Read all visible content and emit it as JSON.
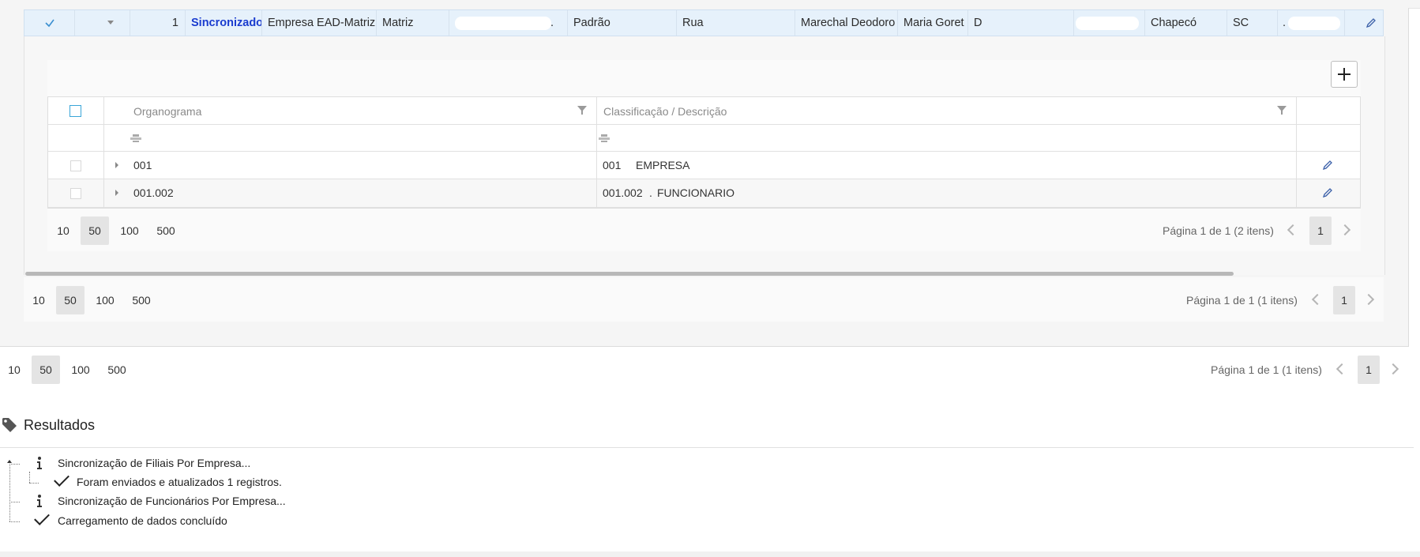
{
  "main_row": {
    "number": "1",
    "status": "Sincronizado",
    "empresa": "Empresa EAD-Matriz",
    "tipo": "Matriz",
    "masked_suffix": ".",
    "padrao": "Padrão",
    "logradouro_tipo": "Rua",
    "logradouro": "Marechal Deodoro",
    "nome": "Maria Goret",
    "letra": "D",
    "cidade": "Chapecó",
    "uf": "SC",
    "masked_suffix2": "."
  },
  "inner_grid": {
    "col_org": "Organograma",
    "col_desc": "Classificação / Descrição",
    "rows": [
      {
        "org": "001",
        "code": "001",
        "desc": "EMPRESA"
      },
      {
        "org": "001.002",
        "code": "001.002",
        "dot": ".",
        "desc": "FUNCIONARIO"
      }
    ]
  },
  "pager_inner": {
    "sizes": [
      "10",
      "50",
      "100",
      "500"
    ],
    "selected": "50",
    "info": "Página 1 de 1 (2 itens)",
    "page": "1"
  },
  "pager_middle": {
    "sizes": [
      "10",
      "50",
      "100",
      "500"
    ],
    "selected": "50",
    "info": "Página 1 de 1 (1 itens)",
    "page": "1"
  },
  "pager_outer": {
    "sizes": [
      "10",
      "50",
      "100",
      "500"
    ],
    "selected": "50",
    "info": "Página 1 de 1 (1 itens)",
    "page": "1"
  },
  "results": {
    "title": "Resultados",
    "items": [
      "Sincronização de Filiais Por Empresa...",
      "Foram enviados e atualizados 1 registros.",
      "Sincronização de Funcionários Por Empresa...",
      "Carregamento de dados concluído"
    ]
  },
  "icons": {
    "check": "check-icon",
    "expand": "caret-down-icon",
    "edit": "pencil-icon",
    "add": "plus-icon",
    "filter": "filter-icon",
    "tag": "tag-icon",
    "info": "info-icon"
  },
  "colors": {
    "status_blue": "#1a3ccf",
    "row_selected": "#e6f1fb",
    "accent": "#3aa6d8"
  }
}
